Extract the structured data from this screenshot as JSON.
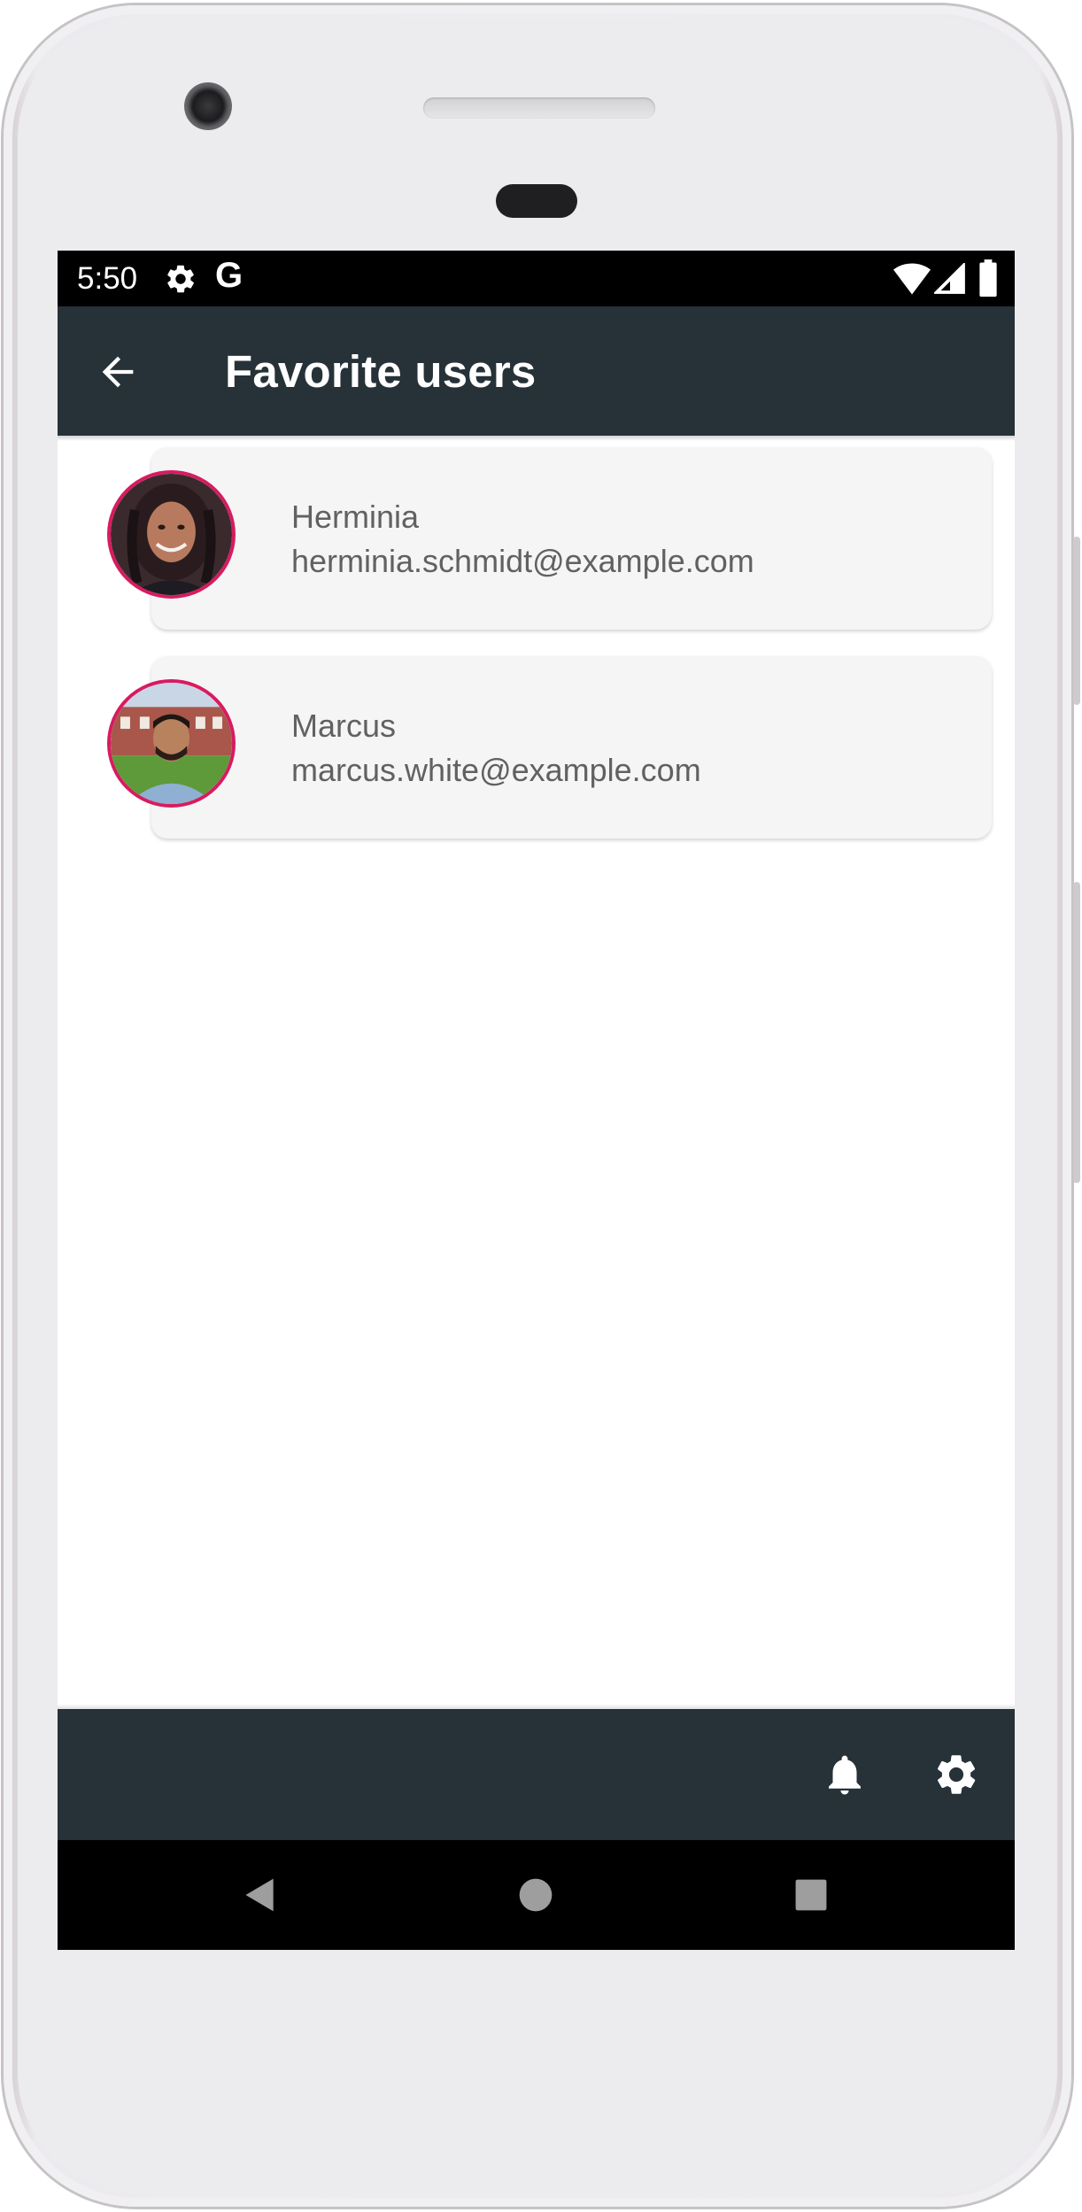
{
  "status_bar": {
    "time": "5:50",
    "google_letter": "G",
    "icons": [
      "gear-icon",
      "wifi-icon",
      "signal-icon",
      "battery-icon"
    ]
  },
  "app_bar": {
    "title": "Favorite users",
    "back_icon": "arrow-back-icon",
    "background_color": "#263238"
  },
  "users": [
    {
      "name": "Herminia",
      "email": "herminia.schmidt@example.com"
    },
    {
      "name": "Marcus",
      "email": "marcus.white@example.com"
    }
  ],
  "bottom_bar": {
    "icons": [
      "bell-icon",
      "gear-icon"
    ],
    "background_color": "#263238"
  },
  "nav_bar": {
    "icons": [
      "nav-back-icon",
      "nav-home-icon",
      "nav-recent-icon"
    ]
  },
  "colors": {
    "accent": "#d81b60",
    "card_background": "#f5f5f5",
    "text": "#616161"
  }
}
